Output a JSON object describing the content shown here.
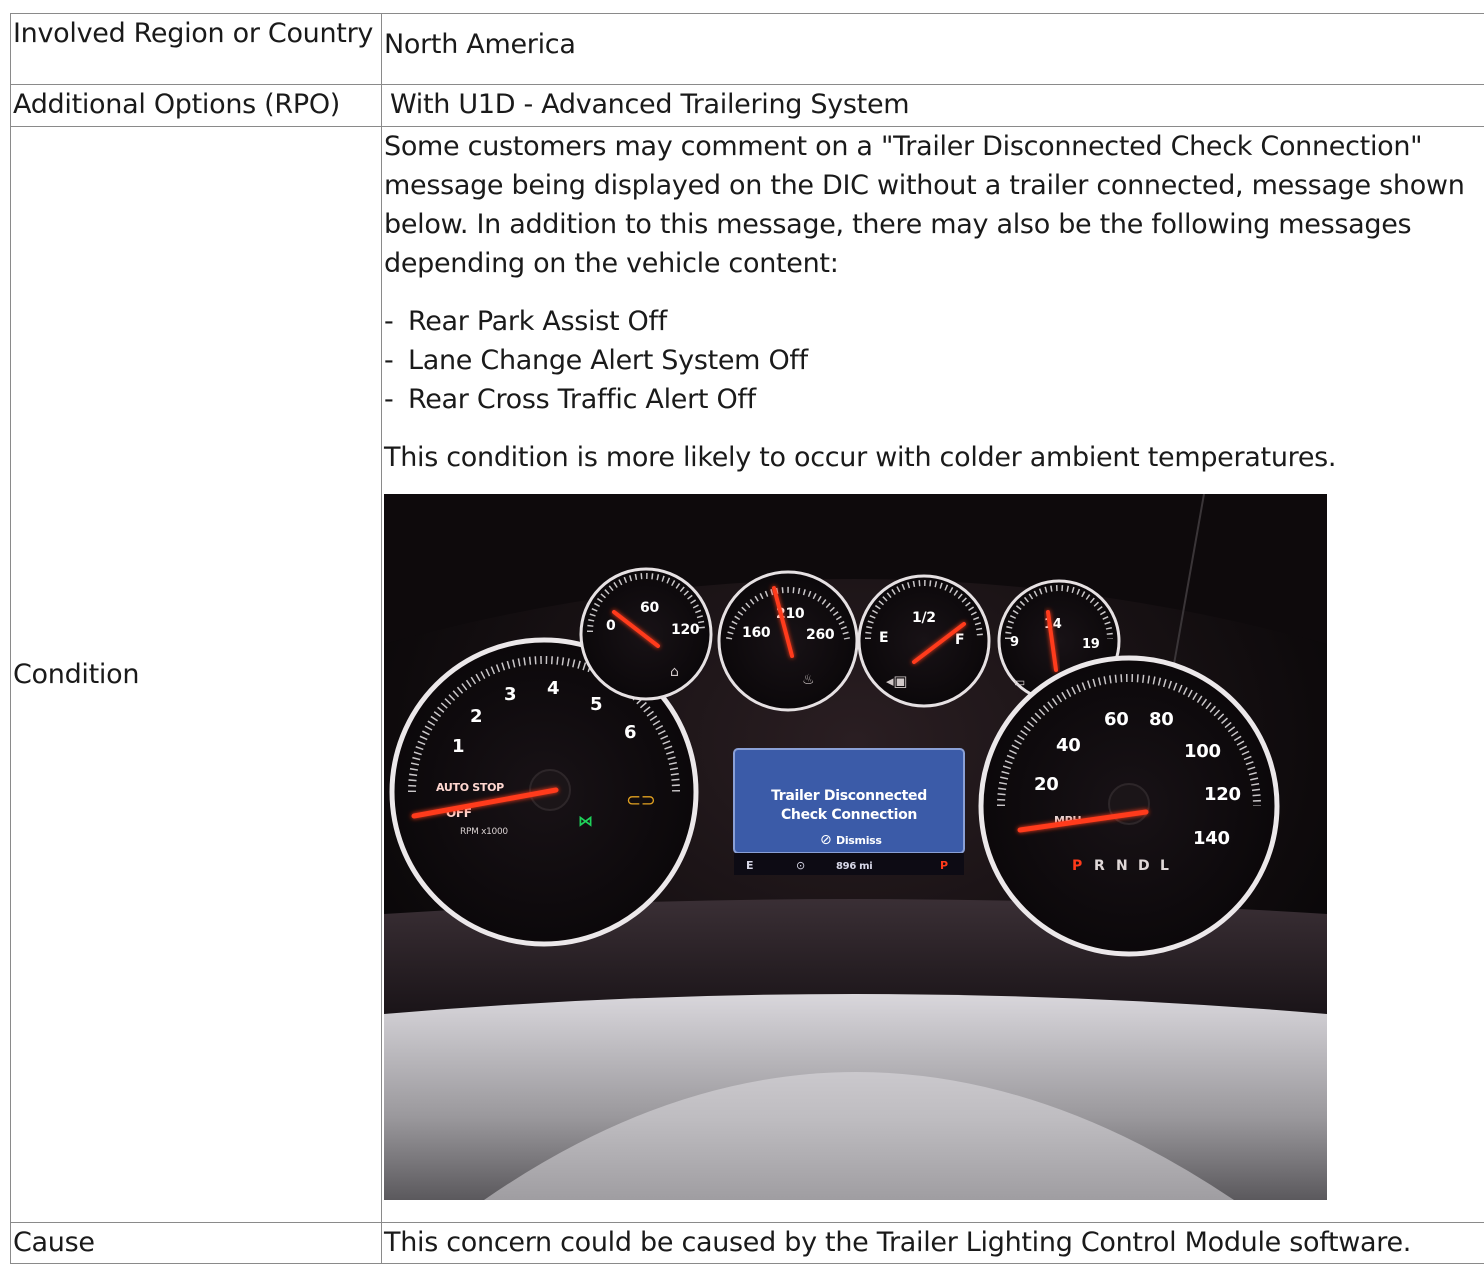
{
  "rows": {
    "region": {
      "label": "Involved Region or Country",
      "value": "North America"
    },
    "rpo": {
      "label": "Additional Options (RPO)",
      "value": "With U1D - Advanced Trailering System"
    },
    "condition": {
      "label": "Condition",
      "intro": "Some customers may comment on a \"Trailer Disconnected Check Connection\" message being displayed on the DIC without a trailer connected,  message shown below.  In addition to this message, there may also be the following messages depending on the vehicle content:",
      "messages": [
        "Rear Park Assist Off",
        "Lane Change Alert System Off",
        "Rear Cross Traffic Alert Off"
      ],
      "note": "This condition is more likely to occur with colder ambient temperatures."
    },
    "cause": {
      "label": "Cause",
      "value": "This concern could be caused by the Trailer Lighting Control Module software."
    }
  },
  "cluster_photo": {
    "tach_ticks": [
      "1",
      "2",
      "3",
      "4",
      "5",
      "6"
    ],
    "tach_labels": {
      "auto_stop": "AUTO STOP",
      "off": "OFF",
      "rpm": "RPM x1000"
    },
    "oil_ticks": [
      "0",
      "60",
      "120"
    ],
    "temp_ticks": [
      "160",
      "210",
      "260"
    ],
    "fuel_ticks": [
      "E",
      "1/2",
      "F"
    ],
    "volt_ticks": [
      "9",
      "14",
      "19"
    ],
    "speed_ticks": [
      "20",
      "40",
      "60",
      "80",
      "100",
      "120",
      "140"
    ],
    "speed_unit": "MPH",
    "gear_indicator": [
      "P",
      "R",
      "N",
      "D",
      "L"
    ],
    "dic_message_line1": "Trailer Disconnected",
    "dic_message_line2": "Check Connection",
    "dic_dismiss": "Dismiss",
    "dic_status_range": "896 mi",
    "dic_status_gear": "P",
    "colors": {
      "needle": "#ff3a1a",
      "dic_screen": "#3b5ba8",
      "chrome": "#e8e4e6"
    }
  }
}
